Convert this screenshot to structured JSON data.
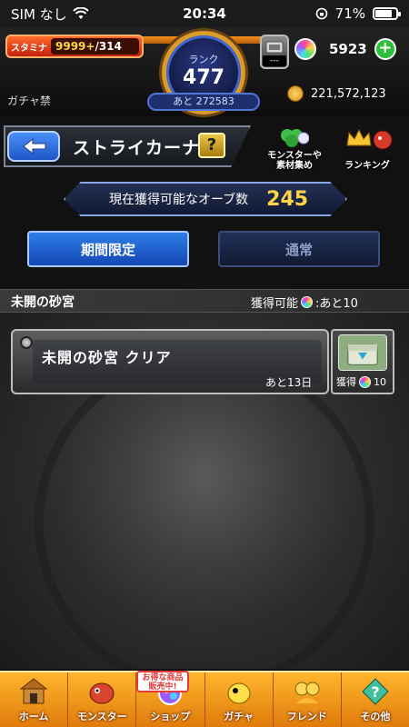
{
  "status_bar": {
    "carrier": "SIM なし",
    "time": "20:34",
    "battery": "71%"
  },
  "hud": {
    "stamina_label": "スタミナ",
    "stamina_current": "9999+",
    "stamina_max": "/314",
    "rank_label": "ランク",
    "rank_value": "477",
    "rank_next": "あと 272583",
    "gacha_ban": "ガチャ禁",
    "energy_tag": "---",
    "orb_count": "5923",
    "coins": "221,572,123"
  },
  "title_bar": {
    "title": "ストライカーナビ",
    "help_label": "?",
    "collect_label_line1": "モンスターや",
    "collect_label_line2": "素材集め",
    "ranking_label": "ランキング"
  },
  "orb_counter": {
    "label": "現在獲得可能なオーブ数",
    "value": "245"
  },
  "tabs": [
    {
      "label": "期間限定",
      "active": true
    },
    {
      "label": "通常",
      "active": false
    }
  ],
  "dungeon": {
    "name": "未開の砂宮",
    "available_prefix": "獲得可能",
    "available_suffix": ":あと10"
  },
  "quest": {
    "title": "未開の砂宮 クリア",
    "remaining": "あと13日",
    "reward_label": "獲得",
    "reward_count": "10"
  },
  "bottom_nav": {
    "items": [
      {
        "label": "ホーム"
      },
      {
        "label": "モンスター"
      },
      {
        "label": "ショップ"
      },
      {
        "label": "ガチャ"
      },
      {
        "label": "フレンド"
      },
      {
        "label": "その他"
      }
    ],
    "sale_badge_line1": "お得な商品",
    "sale_badge_line2": "販売中!"
  },
  "colors": {
    "accent_orange": "#f39a1c",
    "tab_active": "#2f7ee8",
    "orb_count_gold": "#ffd445"
  }
}
